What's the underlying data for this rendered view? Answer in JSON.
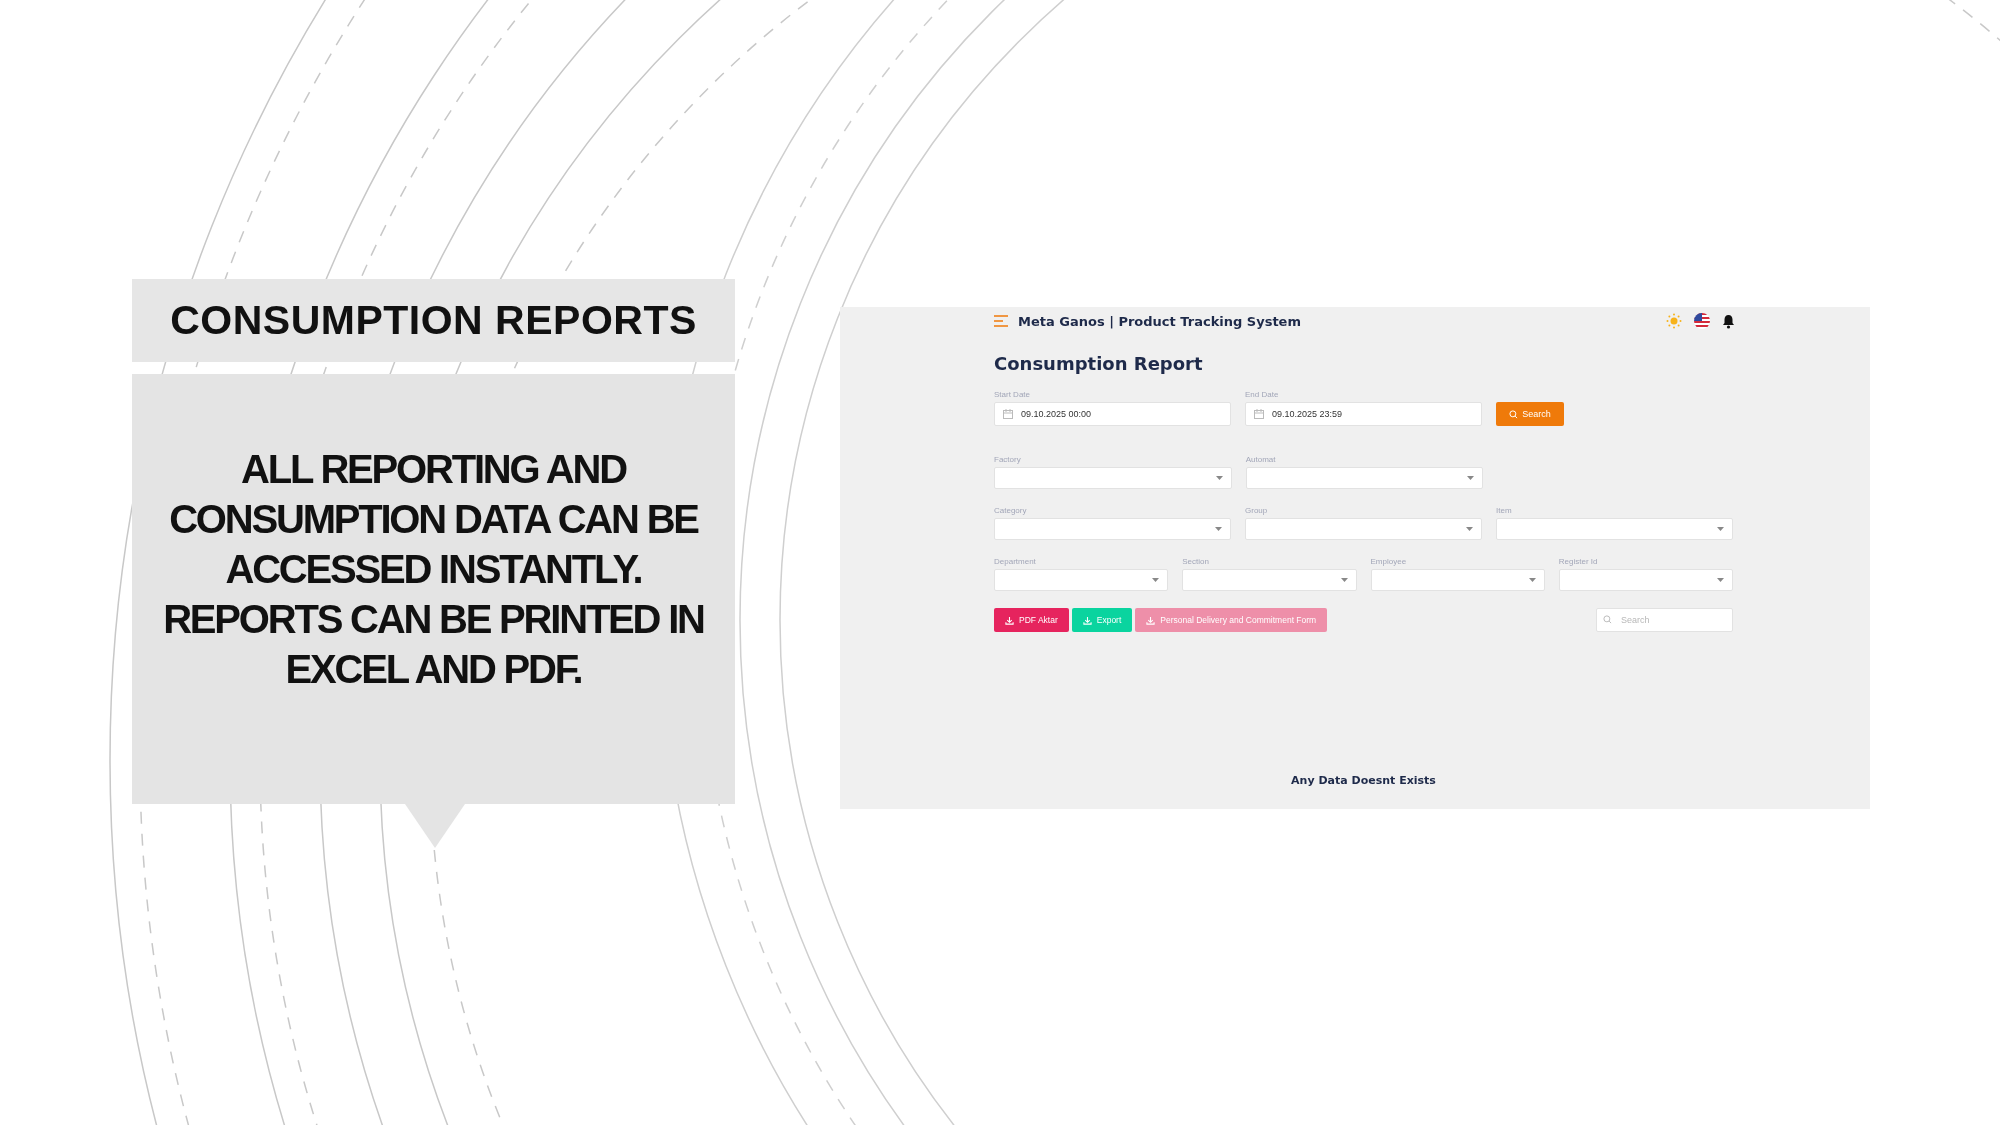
{
  "slide": {
    "title": "CONSUMPTION REPORTS",
    "body": "ALL REPORTING AND CONSUMPTION DATA CAN BE ACCESSED INSTANTLY. REPORTS CAN BE PRINTED IN EXCEL AND PDF."
  },
  "app": {
    "header": {
      "title": "Meta Ganos | Product Tracking System"
    },
    "heading": "Consumption Report",
    "date_fields": [
      {
        "label": "Start Date",
        "value": "09.10.2025 00:00"
      },
      {
        "label": "End Date",
        "value": "09.10.2025 23:59"
      }
    ],
    "search_button": "Search",
    "select_rows": [
      {
        "fields": [
          {
            "label": "Factory"
          },
          {
            "label": "Automat"
          }
        ]
      },
      {
        "fields": [
          {
            "label": "Category"
          },
          {
            "label": "Group"
          },
          {
            "label": "Item"
          }
        ]
      },
      {
        "fields": [
          {
            "label": "Department"
          },
          {
            "label": "Section"
          },
          {
            "label": "Employee"
          },
          {
            "label": "Register Id"
          }
        ]
      }
    ],
    "buttons": [
      {
        "label": "PDF Aktar",
        "color": "#e6245e"
      },
      {
        "label": "Export",
        "color": "#0ad49f"
      },
      {
        "label": "Personal Delivery and Commitment Form",
        "color": "#ee8fa9"
      }
    ],
    "search": {
      "placeholder": "Search"
    },
    "empty_message": "Any Data Doesnt Exists"
  }
}
